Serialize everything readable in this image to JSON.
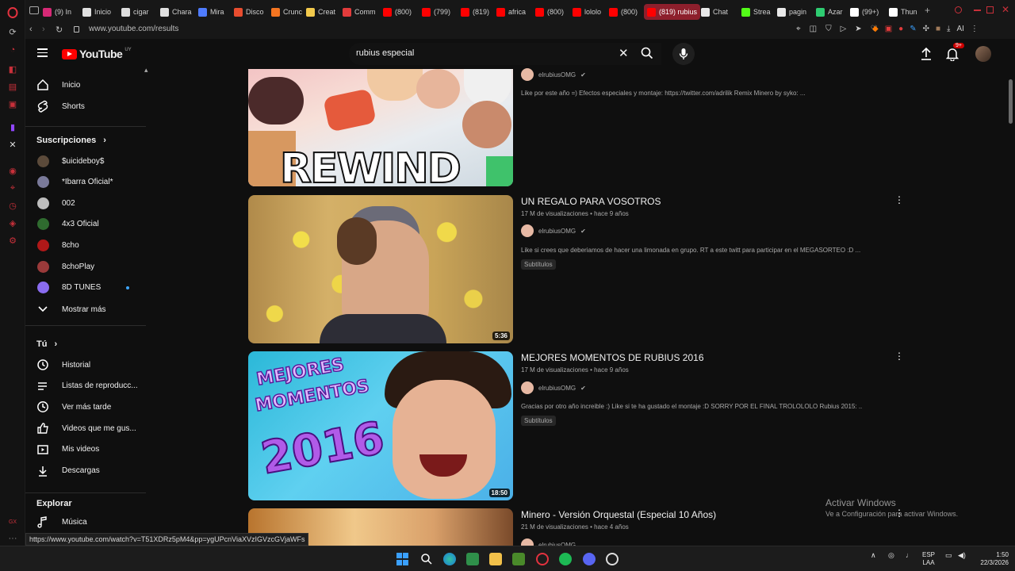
{
  "browser": {
    "tabs": [
      {
        "label": "(9) In",
        "color": "#d62976"
      },
      {
        "label": "Inicio",
        "color": "#e0e0e0"
      },
      {
        "label": "cigar",
        "color": "#dddddd"
      },
      {
        "label": "Chara",
        "color": "#e0e0e0"
      },
      {
        "label": "Mira",
        "color": "#4f7cff"
      },
      {
        "label": "Disco",
        "color": "#e84d2f"
      },
      {
        "label": "Crunc",
        "color": "#f47521"
      },
      {
        "label": "Creat",
        "color": "#f2c94c"
      },
      {
        "label": "Comm",
        "color": "#e23b3b"
      },
      {
        "label": "(800)",
        "color": "#ff0000"
      },
      {
        "label": "(799)",
        "color": "#ff0000"
      },
      {
        "label": "(819)",
        "color": "#ff0000"
      },
      {
        "label": "africa",
        "color": "#ff0000"
      },
      {
        "label": "(800)",
        "color": "#ff0000"
      },
      {
        "label": "lololo",
        "color": "#ff0000"
      },
      {
        "label": "(800)",
        "color": "#ff0000"
      },
      {
        "label": "(819) rubius",
        "color": "#ff0000"
      },
      {
        "label": "Chat",
        "color": "#e8e8e8"
      },
      {
        "label": "Strea",
        "color": "#53fc18"
      },
      {
        "label": "pagin",
        "color": "#e8e8e8"
      },
      {
        "label": "Azar",
        "color": "#2ecc71"
      },
      {
        "label": "(99+)",
        "color": "#ffffff"
      },
      {
        "label": "Thun",
        "color": "#ffffff"
      }
    ],
    "url": "www.youtube.com/results",
    "status_url": "https://www.youtube.com/watch?v=T51XDRz5pM4&pp=ygUPcnViaXVzIGVzcGVjaWFs",
    "ai_label": "AI"
  },
  "masthead": {
    "logo_text": "YouTube",
    "region": "UY",
    "search_value": "rubius especial",
    "notif_count": "9+"
  },
  "sidebar": {
    "main": [
      {
        "label": "Inicio",
        "icon": "home-icon"
      },
      {
        "label": "Shorts",
        "icon": "shorts-icon"
      }
    ],
    "subs_title": "Suscripciones",
    "subs": [
      {
        "label": "$uicideboy$",
        "color": "#5b4a3a"
      },
      {
        "label": "*Ibarra Oficial*",
        "color": "#7a7a9a"
      },
      {
        "label": "002",
        "color": "#bdbdbd"
      },
      {
        "label": "4x3 Oficial",
        "color": "#2f6b2f"
      },
      {
        "label": "8cho",
        "color": "#b01818"
      },
      {
        "label": "8choPlay",
        "color": "#9a3a3a"
      },
      {
        "label": "8D TUNES",
        "color": "#8a6cf0"
      }
    ],
    "show_more": "Mostrar más",
    "you_title": "Tú",
    "you": [
      {
        "label": "Historial",
        "icon": "history-icon"
      },
      {
        "label": "Listas de reproducc...",
        "icon": "playlists-icon"
      },
      {
        "label": "Ver más tarde",
        "icon": "watch-later-icon"
      },
      {
        "label": "Videos que me gus...",
        "icon": "like-icon"
      },
      {
        "label": "Mis videos",
        "icon": "my-videos-icon"
      },
      {
        "label": "Descargas",
        "icon": "download-icon"
      }
    ],
    "explore_title": "Explorar",
    "explore": [
      {
        "label": "Música",
        "icon": "music-icon"
      }
    ]
  },
  "results": [
    {
      "title": "",
      "meta": "",
      "channel": "elrubiusOMG",
      "desc": "Like por este año =) Efectos especiales y montaje: https://twitter.com/adrilik Remix Minero by syko: ...",
      "badge": "",
      "duration": "",
      "thumb_text": "REWIND"
    },
    {
      "title": "UN REGALO PARA VOSOTROS",
      "meta": "17 M de visualizaciones • hace 9 años",
      "channel": "elrubiusOMG",
      "desc": "Like si crees que deberiamos de hacer una limonada en grupo. RT a este twitt para participar en el MEGASORTEO :D ...",
      "badge": "Subtítulos",
      "duration": "5:36",
      "thumb_text": ""
    },
    {
      "title": "MEJORES MOMENTOS DE RUBIUS 2016",
      "meta": "17 M de visualizaciones • hace 9 años",
      "channel": "elrubiusOMG",
      "desc": "Gracias por otro año increible :) Like si te ha gustado el montaje :D SORRY POR EL FINAL TROLOLOLO Rubius 2015: ...",
      "badge": "Subtítulos",
      "duration": "18:50",
      "thumb_text_1": "MEJORES",
      "thumb_text_2": "MOMENTOS",
      "thumb_text_3": "2016"
    },
    {
      "title": "Minero - Versión Orquestal (Especial 10 Años)",
      "meta": "21 M de visualizaciones • hace 4 años",
      "channel": "elrubiusOMG"
    }
  ],
  "watermark": {
    "line1": "Activar Windows",
    "line2": "Ve a Configuración para activar Windows."
  },
  "taskbar": {
    "lang1": "ESP",
    "lang2": "LAA",
    "time": "1:50",
    "date": "22/3/2026"
  }
}
